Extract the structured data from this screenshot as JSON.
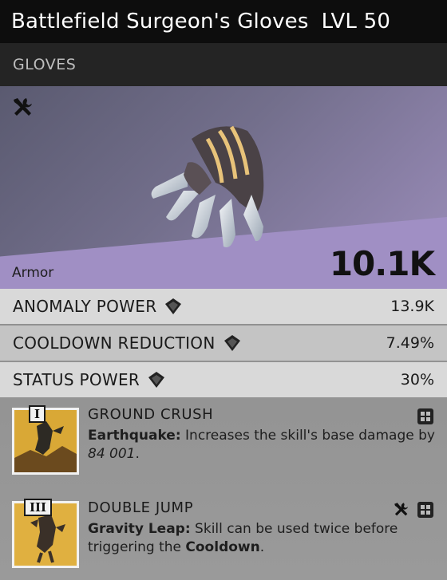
{
  "header": {
    "item_name": "Battlefield Surgeon's Gloves",
    "level": "LVL 50",
    "category": "GLOVES"
  },
  "hero": {
    "corner_icon": "crossed-tools-icon",
    "image": "gloves-icon",
    "armor_label": "Armor",
    "armor_value": "10.1K"
  },
  "stats": [
    {
      "name": "ANOMALY POWER",
      "value": "13.9K",
      "icon": "anomaly-gem-icon"
    },
    {
      "name": "COOLDOWN REDUCTION",
      "value": "7.49%",
      "icon": "anomaly-gem-icon"
    },
    {
      "name": "STATUS POWER",
      "value": "30%",
      "icon": "anomaly-gem-icon"
    }
  ],
  "mods": [
    {
      "rank": "I",
      "title": "GROUND CRUSH",
      "desc_name": "Earthquake:",
      "desc_text": " Increases the skill's base damage by ",
      "desc_number": "84 001",
      "desc_end": ".",
      "icons": [
        "grid-icon"
      ]
    },
    {
      "rank": "III",
      "title": "DOUBLE JUMP",
      "desc_name": "Gravity Leap:",
      "desc_text": " Skill can be used twice before triggering the ",
      "desc_bold": "Cooldown",
      "desc_end": ".",
      "icons": [
        "crossed-tools-icon",
        "grid-icon"
      ]
    }
  ],
  "colors": {
    "title_bar": "#0d0d0d",
    "hero_purple": "#9b8eb8",
    "armor_band": "#a08fc4",
    "mod_thumb": "#d8a93a"
  }
}
